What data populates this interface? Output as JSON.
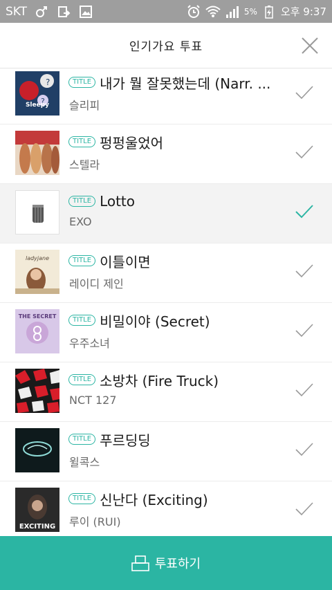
{
  "statusbar": {
    "carrier": "SKT",
    "battery": "5%",
    "time": "오후 9:37"
  },
  "header": {
    "title": "인기가요 투표"
  },
  "badge_label": "TITLE",
  "items": [
    {
      "title": "내가 뭘 잘못했는데 (Narr. ...",
      "artist": "슬리피",
      "selected": false,
      "cover_text": "Sleepy"
    },
    {
      "title": "펑펑울었어",
      "artist": "스텔라",
      "selected": false,
      "cover_text": ""
    },
    {
      "title": "Lotto",
      "artist": "EXO",
      "selected": true,
      "cover_text": ""
    },
    {
      "title": "이틀이면",
      "artist": "레이디 제인",
      "selected": false,
      "cover_text": "ladyjane"
    },
    {
      "title": "비밀이야 (Secret)",
      "artist": "우주소녀",
      "selected": false,
      "cover_text": "THE SECRET"
    },
    {
      "title": "소방차 (Fire Truck)",
      "artist": "NCT 127",
      "selected": false,
      "cover_text": ""
    },
    {
      "title": "푸르딩딩",
      "artist": "윌콕스",
      "selected": false,
      "cover_text": ""
    },
    {
      "title": "신난다 (Exciting)",
      "artist": "루이 (RUI)",
      "selected": false,
      "cover_text": "EXCITING"
    }
  ],
  "vote_button": {
    "label": "투표하기"
  },
  "colors": {
    "accent": "#2bb5a3",
    "check_inactive": "#9a9a9a",
    "statusbar": "#9e9e9e"
  },
  "icons": {
    "close": "close-icon",
    "check": "checkmark-icon",
    "vote": "ballot-box-icon"
  }
}
